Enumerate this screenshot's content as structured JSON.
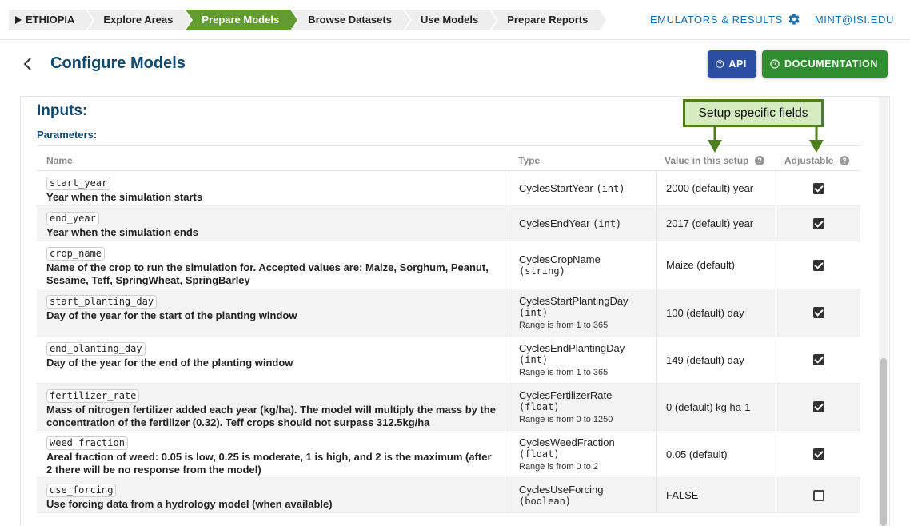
{
  "breadcrumbs": [
    {
      "label": "ETHIOPIA",
      "active": false
    },
    {
      "label": "Explore Areas",
      "active": false
    },
    {
      "label": "Prepare Models",
      "active": true
    },
    {
      "label": "Browse Datasets",
      "active": false
    },
    {
      "label": "Use Models",
      "active": false
    },
    {
      "label": "Prepare Reports",
      "active": false
    }
  ],
  "top_links": {
    "emulators": "EMULATORS & RESULTS",
    "user": "MINT@ISI.EDU"
  },
  "header": {
    "title": "Configure Models",
    "api_label": "API",
    "doc_label": "DOCUMENTATION"
  },
  "section": {
    "inputs_title": "Inputs:",
    "parameters_title": "Parameters:"
  },
  "annotation": "Setup specific fields",
  "table": {
    "columns": [
      "Name",
      "Type",
      "Value in this setup",
      "Adjustable"
    ],
    "rows": [
      {
        "code": "start_year",
        "description": "Year when the simulation starts",
        "type_name": "CyclesStartYear",
        "type_kind": "(int)",
        "type_inline": true,
        "range": "",
        "value": "2000 (default) year",
        "adjustable": true
      },
      {
        "code": "end_year",
        "description": "Year when the simulation ends",
        "type_name": "CyclesEndYear",
        "type_kind": "(int)",
        "type_inline": true,
        "range": "",
        "value": "2017 (default) year",
        "adjustable": true
      },
      {
        "code": "crop_name",
        "description": "Name of the crop to run the simulation for. Accepted values are: Maize, Sorghum, Peanut, Sesame, Teff, SpringWheat, SpringBarley",
        "type_name": "CyclesCropName",
        "type_kind": "(string)",
        "type_inline": false,
        "range": "",
        "value": "Maize (default)",
        "adjustable": true
      },
      {
        "code": "start_planting_day",
        "description": "Day of the year for the start of the planting window",
        "type_name": "CyclesStartPlantingDay",
        "type_kind": "(int)",
        "type_inline": false,
        "range": "Range is from 1 to 365",
        "value": "100 (default) day",
        "adjustable": true
      },
      {
        "code": "end_planting_day",
        "description": "Day of the year for the end of the planting window",
        "type_name": "CyclesEndPlantingDay",
        "type_kind": "(int)",
        "type_inline": false,
        "range": "Range is from 1 to 365",
        "value": "149 (default) day",
        "adjustable": true
      },
      {
        "code": "fertilizer_rate",
        "description": "Mass of nitrogen fertilizer added each year (kg/ha). The model will multiply the mass by the concentration of the fertilizer (0.32). Teff crops should not surpass 312.5kg/ha",
        "type_name": "CyclesFertilizerRate",
        "type_kind": "(float)",
        "type_inline": false,
        "range": "Range is from 0 to 1250",
        "value": "0 (default) kg ha-1",
        "adjustable": true
      },
      {
        "code": "weed_fraction",
        "description": "Areal fraction of weed: 0.05 is low, 0.25 is moderate, 1 is high, and 2 is the maximum (after 2 there will be no response from the model)",
        "type_name": "CyclesWeedFraction",
        "type_kind": "(float)",
        "type_inline": false,
        "range": "Range is from 0 to 2",
        "value": "0.05 (default)",
        "adjustable": true
      },
      {
        "code": "use_forcing",
        "description": "Use forcing data from a hydrology model (when available)",
        "type_name": "CyclesUseForcing",
        "type_kind": "(boolean)",
        "type_inline": false,
        "range": "",
        "value": "FALSE",
        "adjustable": false
      }
    ]
  },
  "colors": {
    "active_crumb": "#629b30",
    "api_button": "#2b4da2",
    "doc_button": "#2f8d2f",
    "title": "#0f4a6e",
    "link": "#1a6ea8",
    "annotation_fill": "#d4ecc0",
    "annotation_border": "#4f7f1d"
  }
}
